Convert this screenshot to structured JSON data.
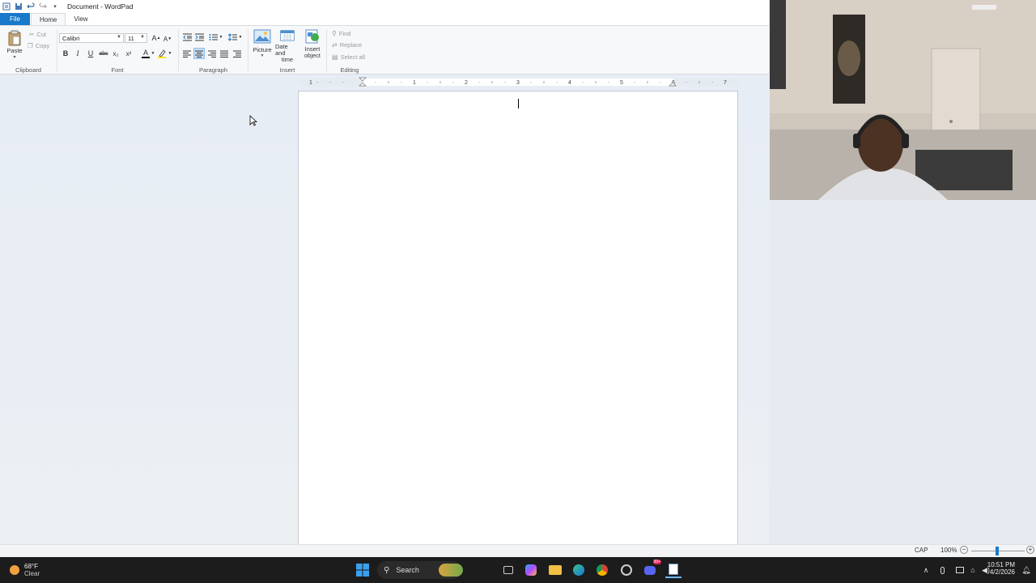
{
  "window": {
    "title": "Document - WordPad"
  },
  "tabs": [
    {
      "label": "File"
    },
    {
      "label": "Home"
    },
    {
      "label": "View"
    }
  ],
  "ribbon": {
    "clipboard": {
      "paste": "Paste",
      "cut": "Cut",
      "copy": "Copy",
      "group_label": "Clipboard"
    },
    "font": {
      "family": "Calibri",
      "size": "11",
      "group_label": "Font",
      "bold": "B",
      "italic": "I",
      "underline": "U",
      "strike": "abc",
      "subscript": "x₂",
      "superscript": "x²"
    },
    "paragraph": {
      "group_label": "Paragraph"
    },
    "insert": {
      "picture": "Picture",
      "datetime_line1": "Date and",
      "datetime_line2": "time",
      "object_line1": "Insert",
      "object_line2": "object",
      "group_label": "Insert"
    },
    "editing": {
      "find": "Find",
      "replace": "Replace",
      "select_all": "Select all",
      "group_label": "Editing"
    }
  },
  "ruler": {
    "marks": [
      "1",
      "1",
      "2",
      "3",
      "4",
      "5",
      "6",
      "7"
    ]
  },
  "status": {
    "caps": "CAP",
    "zoom": "100%",
    "zoom_level": 1.0
  },
  "taskbar": {
    "weather_temp": "68°F",
    "weather_desc": "Clear",
    "search": "Search",
    "time": "10:51 PM",
    "date": "4/2/2026",
    "notification_badge": "99+"
  },
  "colors": {
    "file_tab": "#1979ca",
    "workspace": "#e7edf5",
    "taskbar": "#1c1c1c"
  }
}
